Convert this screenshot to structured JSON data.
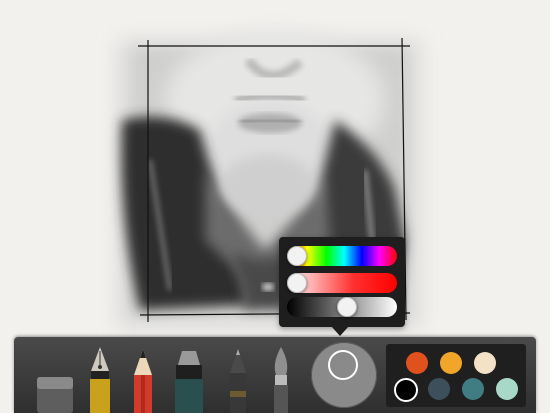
{
  "picker": {
    "hue": 0.0,
    "saturation": 0.0,
    "brightness": 0.55
  },
  "current_color": "#8a8a8a",
  "tools": [
    {
      "name": "eraser-tool",
      "icon": "eraser-icon",
      "color": "#777777"
    },
    {
      "name": "fountain-pen-tool",
      "icon": "fountain-pen-icon",
      "color": "#c9c4bb"
    },
    {
      "name": "pencil-tool",
      "icon": "pencil-icon",
      "color": "#d23a2a"
    },
    {
      "name": "marker-tool",
      "icon": "marker-icon",
      "color": "#2a4f4f"
    },
    {
      "name": "pen-tool",
      "icon": "pen-icon",
      "color": "#3a3a3a"
    },
    {
      "name": "paintbrush-tool",
      "icon": "paintbrush-icon",
      "color": "#555555"
    }
  ],
  "palette": [
    {
      "color": "#e0521d"
    },
    {
      "color": "#f1a62a"
    },
    {
      "color": "#f4e2c6"
    },
    {
      "color": "#000000",
      "selected": true
    },
    {
      "color": "#3d4f5a"
    },
    {
      "color": "#3f7d83"
    },
    {
      "color": "#a8d8c8"
    }
  ]
}
